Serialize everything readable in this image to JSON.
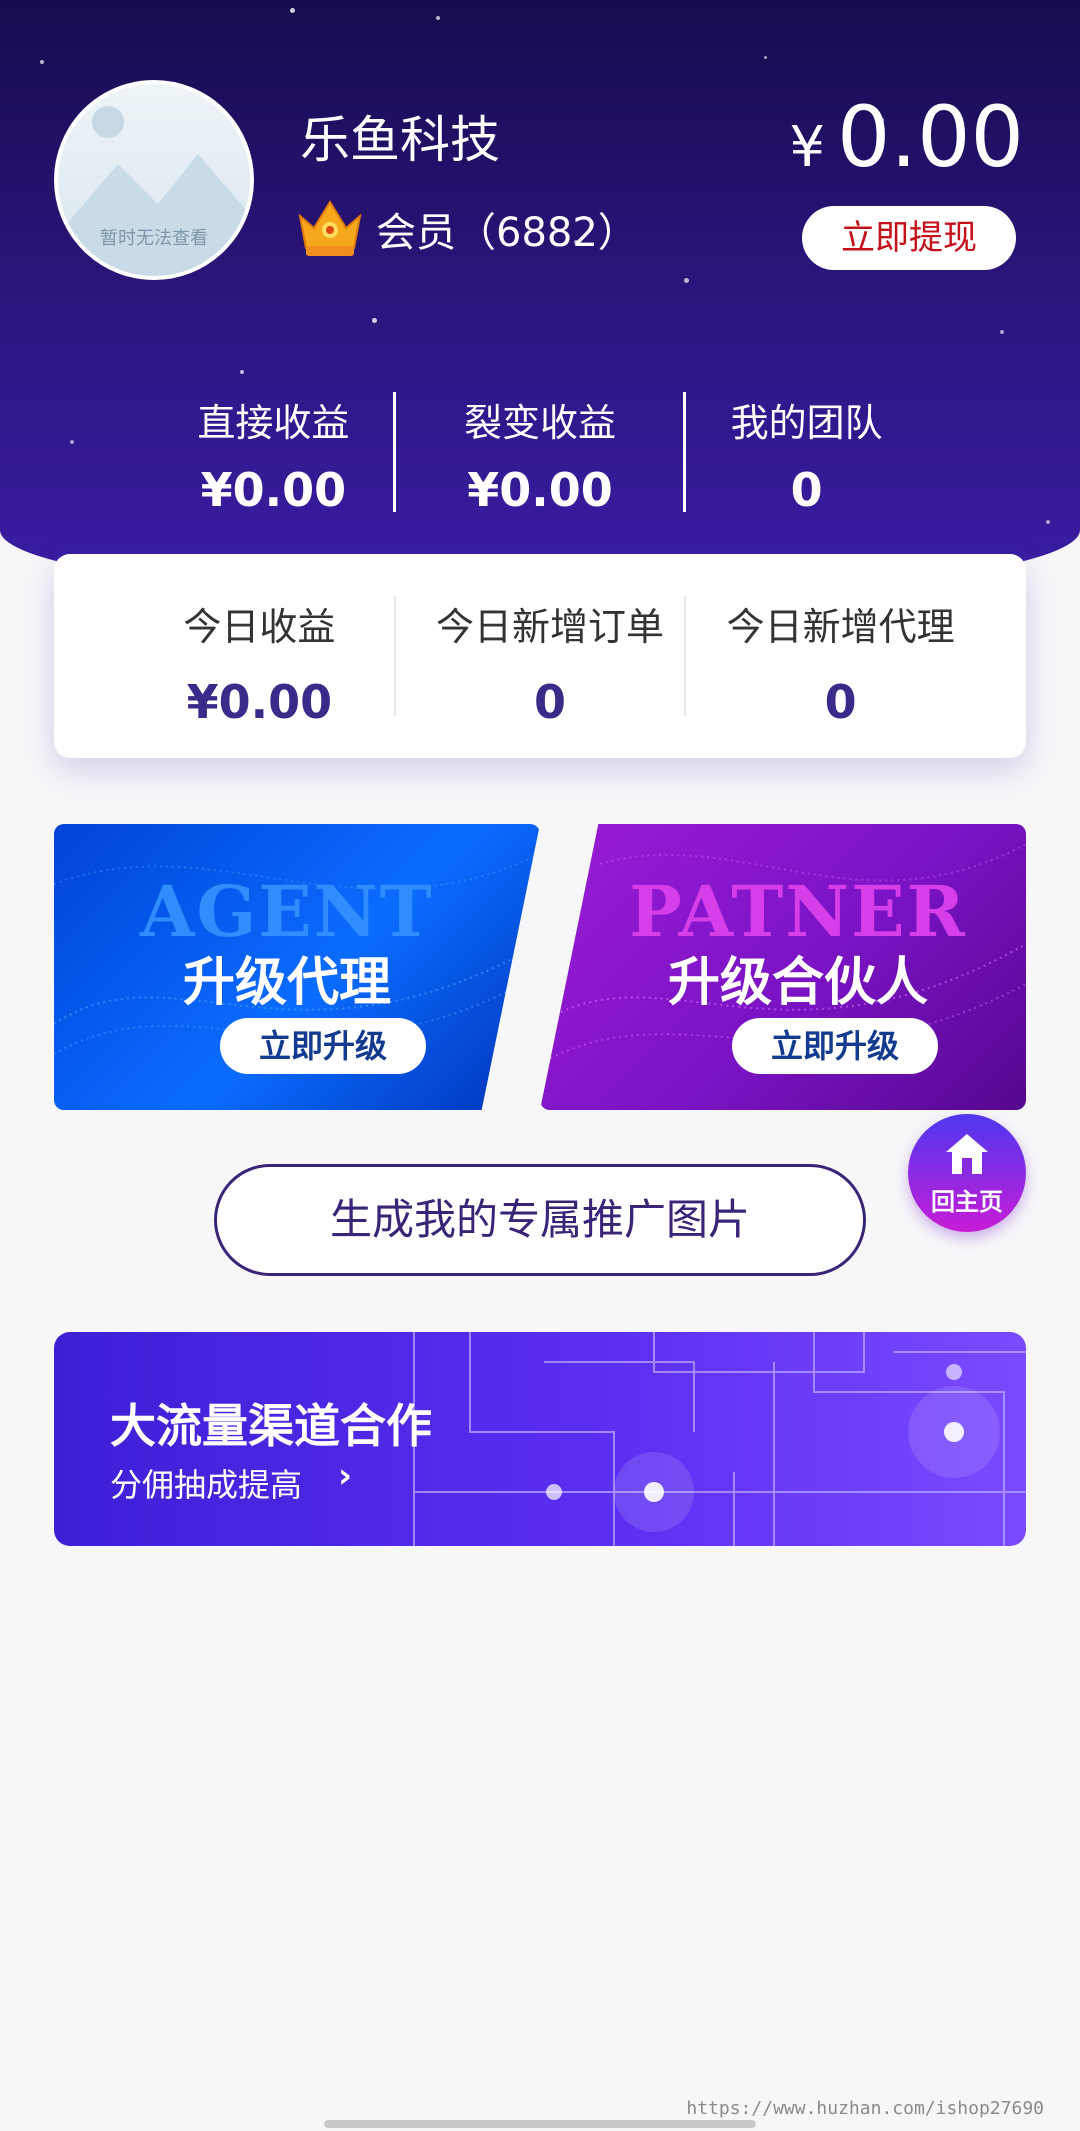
{
  "profile": {
    "avatar_caption": "暂时无法查看",
    "shop_name": "乐鱼科技",
    "member_label": "会员（6882）"
  },
  "balance": {
    "currency": "¥",
    "amount": "0.00",
    "withdraw_label": "立即提现"
  },
  "stats_top": [
    {
      "label": "直接收益",
      "value": "¥0.00"
    },
    {
      "label": "裂变收益",
      "value": "¥0.00"
    },
    {
      "label": "我的团队",
      "value": "0"
    }
  ],
  "stats_today": [
    {
      "label": "今日收益",
      "value": "¥0.00"
    },
    {
      "label": "今日新增订单",
      "value": "0"
    },
    {
      "label": "今日新增代理",
      "value": "0"
    }
  ],
  "promos": {
    "agent": {
      "eng": "AGENT",
      "title": "升级代理",
      "button": "立即升级"
    },
    "partner": {
      "eng": "PATNER",
      "title": "升级合伙人",
      "button": "立即升级"
    }
  },
  "home_button": {
    "label": "回主页",
    "icon": "home-icon"
  },
  "generate_button": {
    "label": "生成我的专属推广图片"
  },
  "banner": {
    "title": "大流量渠道合作",
    "subtitle": "分佣抽成提高",
    "arrow": "›"
  },
  "watermark": "https://www.huzhan.com/ishop27690",
  "colors": {
    "header_dark": "#170b4d",
    "header_light": "#3b1da6",
    "accent_red": "#c4101a",
    "value_purple": "#3a2a8a"
  }
}
